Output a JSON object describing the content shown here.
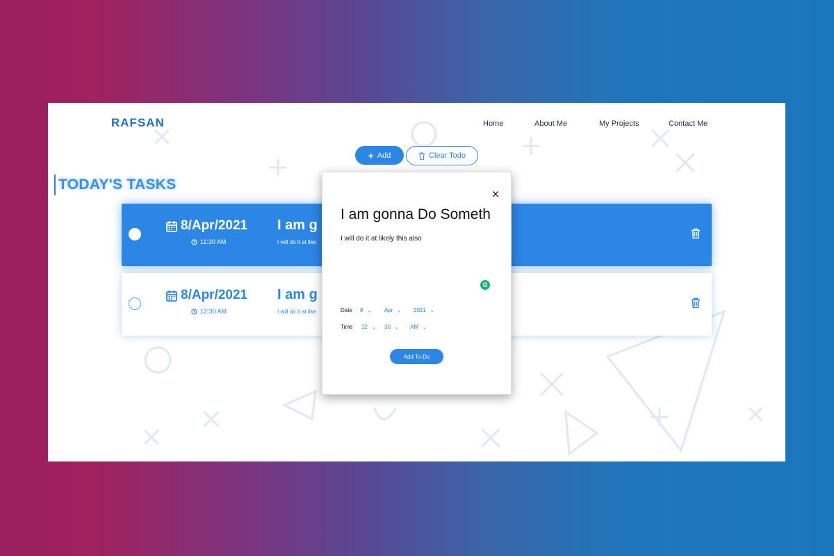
{
  "header": {
    "logo": "RAFSAN",
    "nav": [
      "Home",
      "About Me",
      "My Projects",
      "Contact Me"
    ]
  },
  "toolbar": {
    "add_label": "Add",
    "clear_label": "Clear Todo"
  },
  "section_title": "TODAY'S TASKS",
  "tasks": [
    {
      "date": "8/Apr/2021",
      "time": "11:30 AM",
      "title": "I am g",
      "description": "I will do it at like",
      "state": "active"
    },
    {
      "date": "8/Apr/2021",
      "time": "12:30 AM",
      "title": "I am g",
      "description": "I will do it at like",
      "state": "normal"
    }
  ],
  "modal": {
    "close": "×",
    "title": "I am gonna Do Someth",
    "description": "I will do it at likely this also",
    "grammarly": "G",
    "date_label": "Date",
    "date_day": "8",
    "date_month": "Apr",
    "date_year": "2021",
    "time_label": "Time",
    "time_hour": "12",
    "time_minute": "30",
    "time_period": "AM",
    "submit_label": "Add To-Do"
  },
  "colors": {
    "accent": "#2b86e6",
    "logo": "#1f6fbf",
    "nav_text": "#1e2d52"
  },
  "icons": {
    "add": "plus-icon",
    "clear": "trash-icon",
    "date": "calendar-icon",
    "time": "clock-icon",
    "delete": "trash-icon",
    "close": "close-icon",
    "select": "chevron-down-icon"
  }
}
